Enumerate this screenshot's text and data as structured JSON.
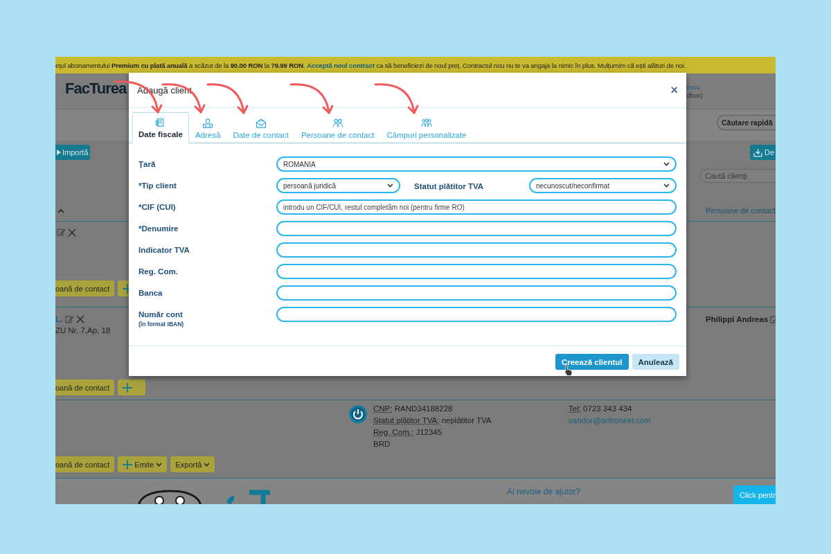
{
  "announcement": {
    "text_before": "ețul abonamentului **Premium cu plată anuală** a scăzut de la **90.00 RON** la **79.99 RON**.",
    "link": "Acceptă noul contract",
    "text_after": "ca să beneficiezi de noul preț. Contractul nou nu te va angaja la nimic în plus. Mulțumim că ești alături de noi."
  },
  "header": {
    "logo": "FacTurea",
    "user_fragment": "escu",
    "account_fragment": "dbox)",
    "quick_search_button": "Căutare rapidă"
  },
  "toolbar": {
    "import_button": "Importă",
    "download_button": "De",
    "search": {
      "placeholder": "Caută clienți"
    }
  },
  "table": {
    "column_header": "Persoane de contact",
    "rows": [
      {
        "actions": [
          {
            "kind": "plain",
            "label": "oană de contact"
          },
          {
            "kind": "issue"
          }
        ]
      },
      {
        "name": "L.",
        "address": "ZU Nr. 7,Ap. 18",
        "contact": "Philippi Andreas",
        "actions": [
          {
            "kind": "plain",
            "label": "oană de contact"
          },
          {
            "kind": "issue"
          }
        ]
      },
      {
        "details": [
          {
            "label": "CNP:",
            "value": "RAND34188228"
          },
          {
            "label": "Statut plătitor TVA:",
            "value": "neplătitor TVA"
          },
          {
            "label": "Reg. Com.:",
            "value": "J12345"
          },
          {
            "value": "BRD"
          }
        ],
        "contact_details": [
          {
            "label": "Tel:",
            "value": "0723 343 434"
          }
        ],
        "email": "sandor@artkonekt.com",
        "actions": [
          {
            "kind": "plain",
            "label": "oană de contact"
          },
          {
            "kind": "issue",
            "label": "Emite"
          },
          {
            "kind": "dropdown",
            "label": "Exportă"
          }
        ]
      }
    ]
  },
  "footer": {
    "help_text": "Ai nevoie de ajutor?",
    "chat_button": "Click pentr"
  },
  "modal": {
    "title": "Adaugă client",
    "close": "×",
    "tabs": [
      {
        "label": "Date fiscale",
        "selected": true
      },
      {
        "label": "Adresă",
        "selected": false
      },
      {
        "label": "Date de contact",
        "selected": false
      },
      {
        "label": "Persoane de contact",
        "selected": false
      },
      {
        "label": "Câmpuri personalizate",
        "selected": false
      }
    ],
    "fields": [
      {
        "kind": "select",
        "label": "Țară",
        "value": "ROMANIA"
      },
      {
        "kind": "select_pair",
        "label": "*Tip client",
        "value": "persoană juridică",
        "second": {
          "label": "Statut plătitor TVA",
          "value": "necunoscut/neconfirmat"
        }
      },
      {
        "kind": "text",
        "label": "*CIF (CUI)",
        "placeholder": "introdu un CIF/CUI, restul completăm noi (pentru firme RO)"
      },
      {
        "kind": "text",
        "label": "*Denumire"
      },
      {
        "kind": "text",
        "label": "Indicator TVA"
      },
      {
        "kind": "text",
        "label": "Reg. Com."
      },
      {
        "kind": "text",
        "label": "Banca"
      },
      {
        "kind": "text",
        "label": "Număr cont",
        "note": "(în format IBAN)"
      }
    ],
    "buttons": [
      {
        "kind": "primary",
        "label": "Creează clientul"
      },
      {
        "kind": "secondary",
        "label": "Anulează"
      }
    ]
  }
}
